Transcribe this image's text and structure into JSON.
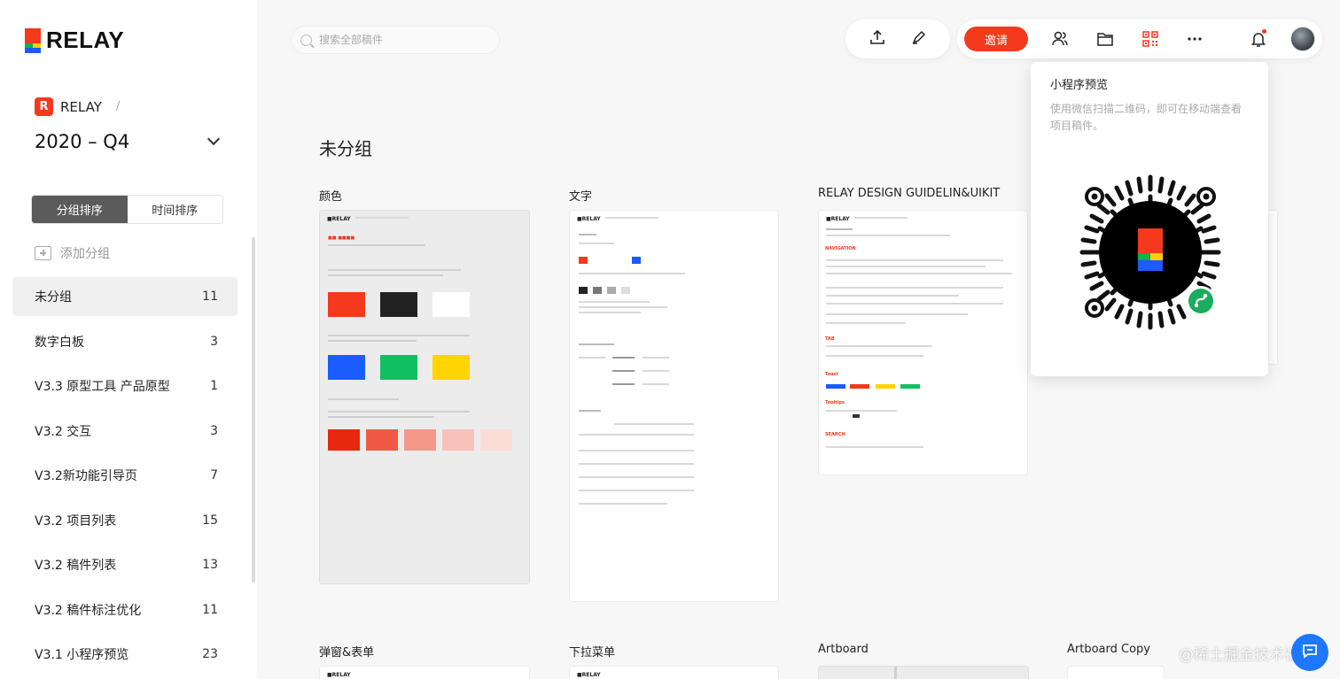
{
  "brand": {
    "logo_text": "RELAY"
  },
  "team": {
    "badge": "R",
    "name": "RELAY",
    "separator": "/"
  },
  "project": {
    "title": "2020 – Q4"
  },
  "sort": {
    "group_label": "分组排序",
    "time_label": "时间排序"
  },
  "add_group_label": "添加分组",
  "groups": [
    {
      "name": "未分组",
      "count": "11"
    },
    {
      "name": "数字白板",
      "count": "3"
    },
    {
      "name": "V3.3 原型工具 产品原型",
      "count": "1"
    },
    {
      "name": "V3.2 交互",
      "count": "3"
    },
    {
      "name": "V3.2新功能引导页",
      "count": "7"
    },
    {
      "name": "V3.2 项目列表",
      "count": "15"
    },
    {
      "name": "V3.2 稿件列表",
      "count": "13"
    },
    {
      "name": "V3.2 稿件标注优化",
      "count": "11"
    },
    {
      "name": "V3.1 小程序预览",
      "count": "23"
    }
  ],
  "search": {
    "placeholder": "搜索全部稿件",
    "value": ""
  },
  "topbar": {
    "invite_label": "邀请"
  },
  "section": {
    "title": "未分组"
  },
  "cards": [
    {
      "label": "颜色"
    },
    {
      "label": "文字"
    },
    {
      "label": "RELAY DESIGN GUIDELIN&UIKIT"
    },
    {
      "label": "弹窗&表单"
    },
    {
      "label": "下拉菜单"
    },
    {
      "label": "Artboard"
    },
    {
      "label": "Artboard Copy"
    }
  ],
  "popover": {
    "title": "小程序预览",
    "description": "使用微信扫描二维码，即可在移动端查看项目稿件。"
  },
  "watermark": "@稀土掘金技术社区",
  "icons": {
    "upload": "upload-icon",
    "pen": "pen-icon",
    "members": "members-icon",
    "folder": "folder-icon",
    "qrcode": "qrcode-icon",
    "more": "more-icon",
    "bell": "bell-icon",
    "search": "search-icon",
    "chat": "chat-icon"
  },
  "colors": {
    "accent": "#f4391d",
    "sidebar_active": "#5b5b5b",
    "chat": "#1e78ff",
    "swatch_red": "#f4391d",
    "swatch_black": "#222222",
    "swatch_blue": "#1a5cff",
    "swatch_green": "#10c060",
    "swatch_yellow": "#ffd400"
  }
}
